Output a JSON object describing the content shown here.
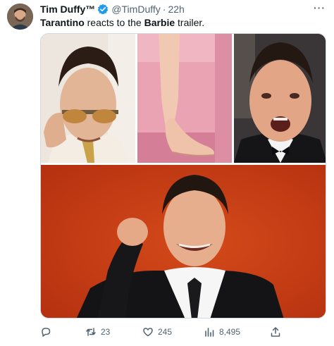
{
  "author": {
    "name": "Tim Duffy™",
    "handle": "@TimDuffy",
    "separator": "·",
    "time": "22h"
  },
  "tweet": {
    "bold_1": "Tarantino",
    "text_1": " reacts to the ",
    "bold_2": "Barbie",
    "text_2": " trailer."
  },
  "more_label": "···",
  "metrics": {
    "reply_count": "",
    "retweets": "23",
    "likes": "245",
    "views": "8,495"
  },
  "colors": {
    "verified": "#1d9bf0",
    "secondary_text": "#536471",
    "red_backdrop": "#c63b14",
    "barbie_pink": "#e8a1b0"
  },
  "icons": [
    "reply-icon",
    "retweet-icon",
    "like-icon",
    "views-icon",
    "share-icon",
    "verified-icon",
    "more-icon"
  ]
}
